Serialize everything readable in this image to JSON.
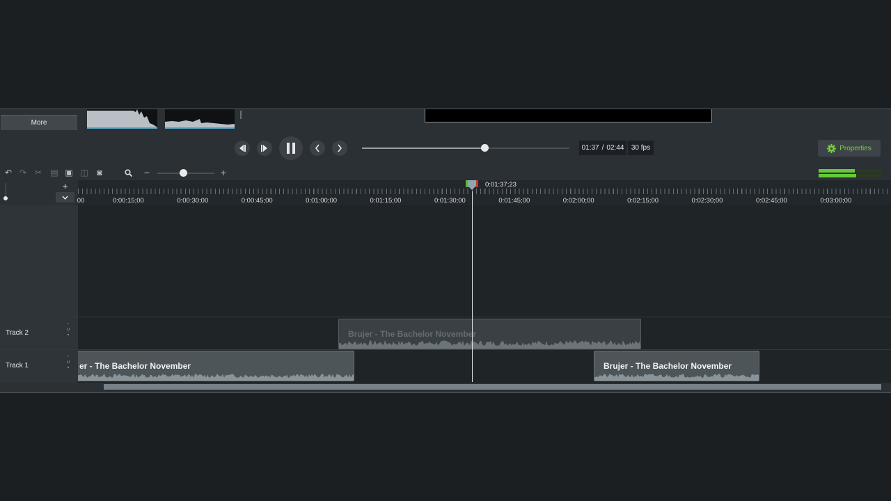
{
  "media": {
    "more_label": "More"
  },
  "playback": {
    "current_time": "01:37",
    "separator": "/",
    "duration": "02:44",
    "fps": "30 fps",
    "progress_fraction": 0.59,
    "properties_label": "Properties"
  },
  "timeline": {
    "zoom_fraction": 0.45,
    "playhead_time": "0:01:37;23",
    "tick_labels": [
      "00",
      "0:00:15;00",
      "0:00:30;00",
      "0:00:45;00",
      "0:01:00;00",
      "0:01:15;00",
      "0:01:30;00",
      "0:01:45;00",
      "0:02:00;00",
      "0:02:15;00",
      "0:02:30;00",
      "0:02:45;00",
      "0:03:00;00"
    ],
    "tracks": [
      {
        "name": "Track 2",
        "clips": [
          {
            "title": "Brujer - The Bachelor November",
            "ghost": true
          }
        ]
      },
      {
        "name": "Track 1",
        "clips": [
          {
            "title": "er - The Bachelor November"
          },
          {
            "title": "Brujer - The Bachelor November"
          }
        ]
      }
    ]
  },
  "meter": {
    "left_level": 0.58,
    "right_level": 0.6
  },
  "colors": {
    "accent": "#7bd13a",
    "background": "#1b1f22",
    "panel": "#2b3034"
  }
}
